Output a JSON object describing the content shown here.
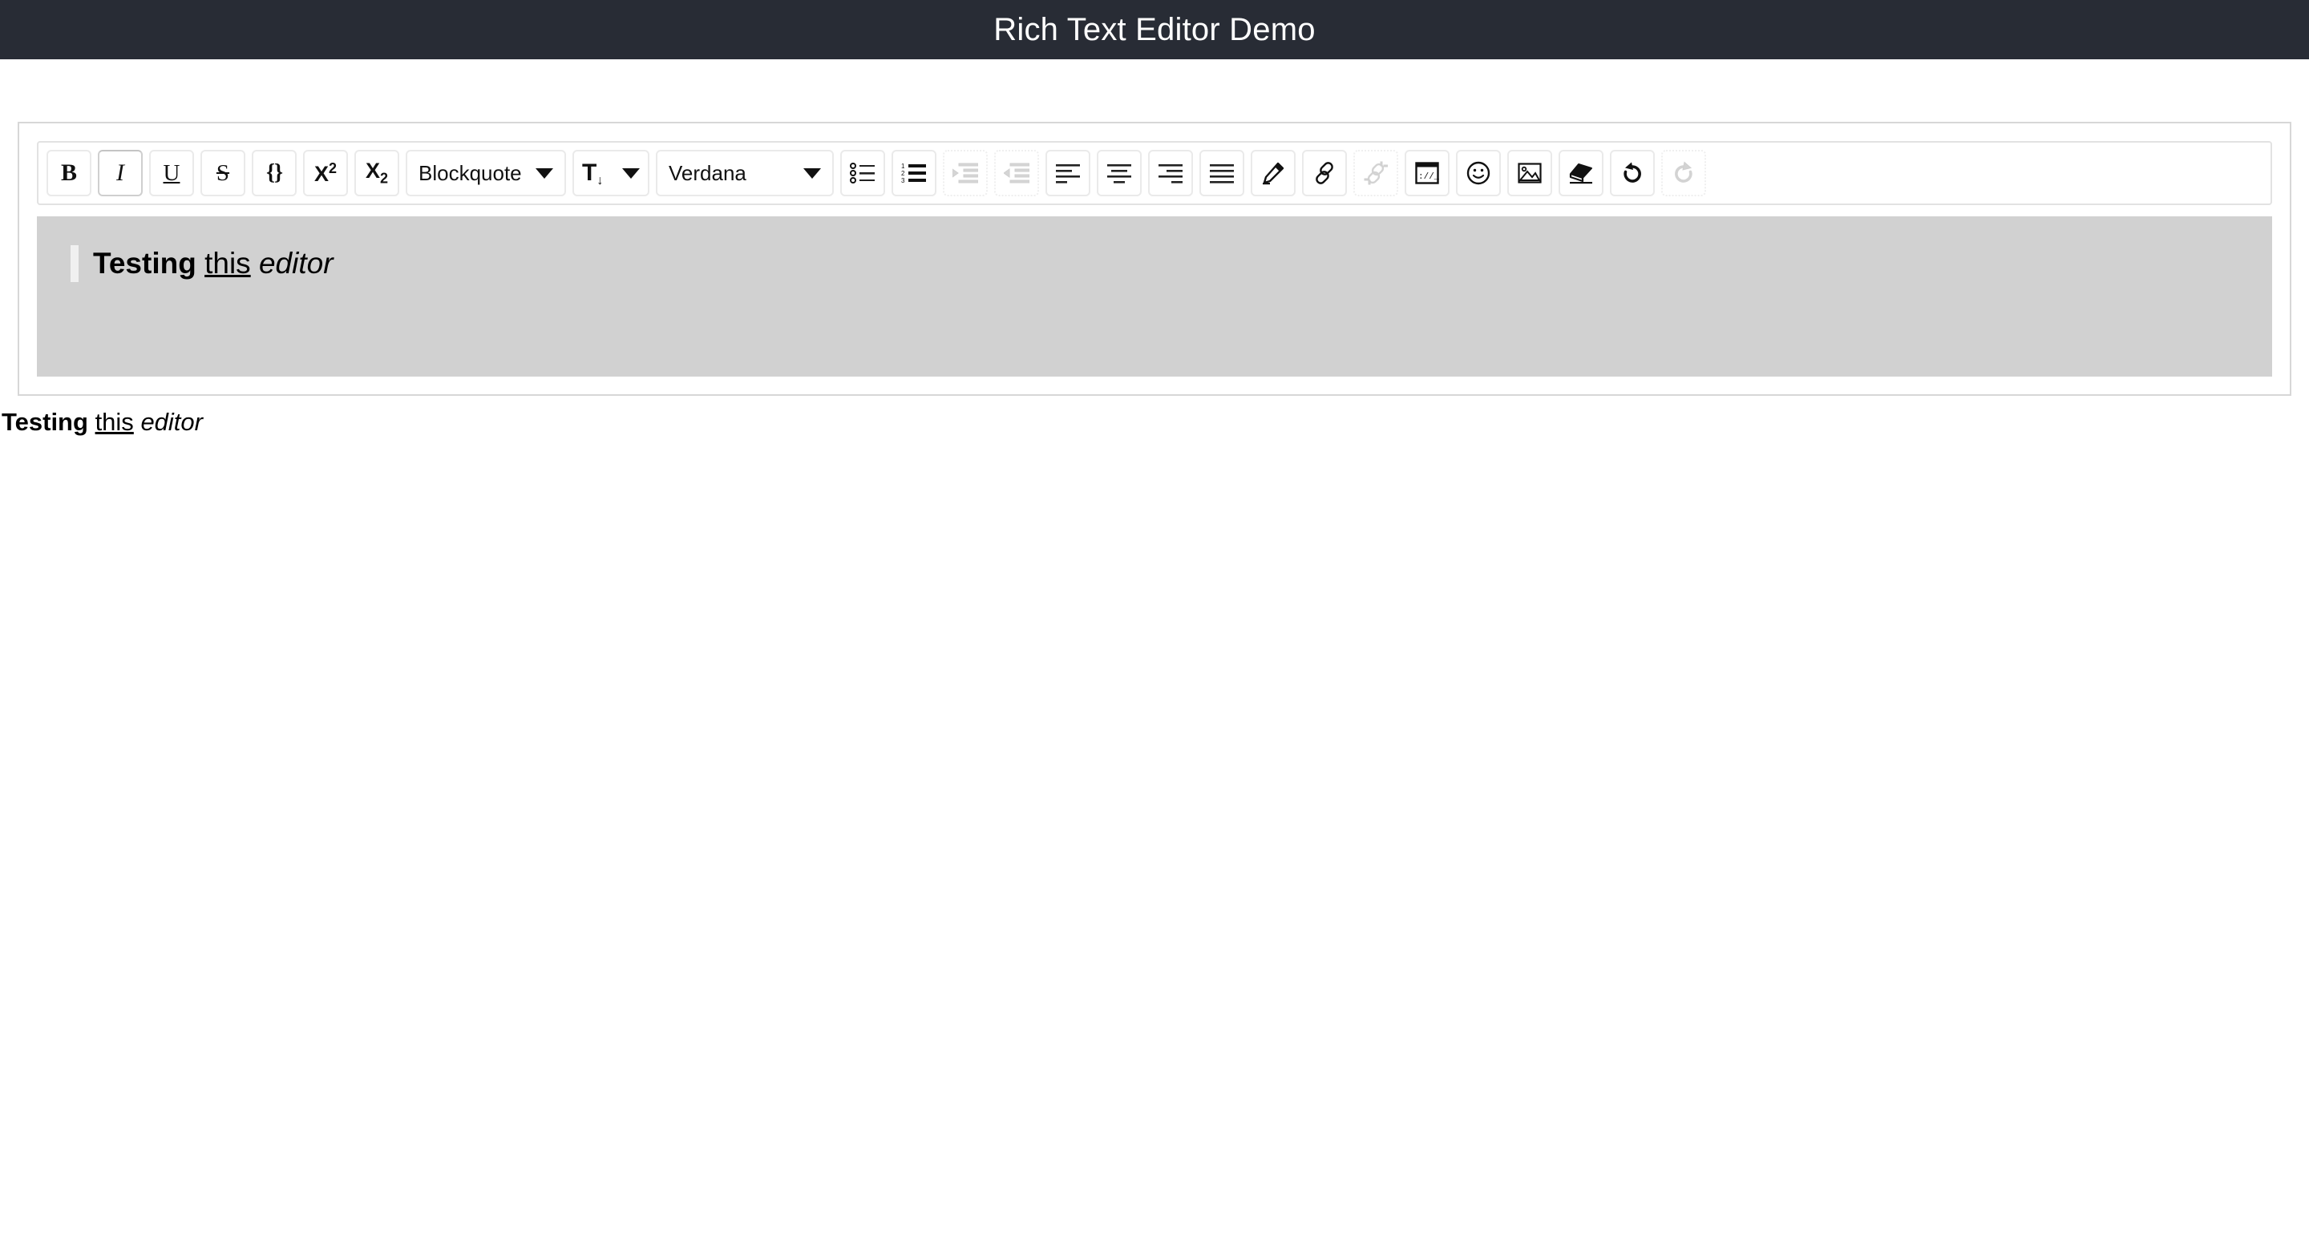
{
  "header": {
    "title": "Rich Text Editor Demo",
    "background": "#282c35",
    "text_color": "#ffffff"
  },
  "toolbar": {
    "buttons": [
      {
        "name": "bold",
        "label": "B",
        "icon": "bold-icon",
        "active": false,
        "disabled": false
      },
      {
        "name": "italic",
        "label": "I",
        "icon": "italic-icon",
        "active": true,
        "disabled": false
      },
      {
        "name": "underline",
        "label": "U",
        "icon": "underline-icon",
        "active": false,
        "disabled": false
      },
      {
        "name": "strikethrough",
        "label": "S",
        "icon": "strikethrough-icon",
        "active": false,
        "disabled": false
      },
      {
        "name": "code",
        "label": "{}",
        "icon": "code-icon",
        "active": false,
        "disabled": false
      },
      {
        "name": "superscript",
        "label": "X2",
        "icon": "superscript-icon",
        "active": false,
        "disabled": false
      },
      {
        "name": "subscript",
        "label": "X2",
        "icon": "subscript-icon",
        "active": false,
        "disabled": false
      }
    ],
    "block_format": {
      "name": "blockquote-dropdown",
      "selected": "Blockquote",
      "icon": "chevron-down-icon"
    },
    "font_size": {
      "name": "font-size-dropdown",
      "icon": "font-size-icon",
      "glyph": "T",
      "arrow": "↓",
      "caret": "chevron-down-icon"
    },
    "font_family": {
      "name": "font-family-dropdown",
      "selected": "Verdana",
      "icon": "chevron-down-icon"
    },
    "icon_buttons": [
      {
        "name": "bullet-list",
        "icon": "bullet-list-icon",
        "disabled": false
      },
      {
        "name": "numbered-list",
        "icon": "numbered-list-icon",
        "disabled": false
      },
      {
        "name": "indent",
        "icon": "indent-icon",
        "disabled": true
      },
      {
        "name": "outdent",
        "icon": "outdent-icon",
        "disabled": true
      },
      {
        "name": "align-left",
        "icon": "align-left-icon",
        "disabled": false
      },
      {
        "name": "align-center",
        "icon": "align-center-icon",
        "disabled": false
      },
      {
        "name": "align-right",
        "icon": "align-right-icon",
        "disabled": false
      },
      {
        "name": "align-justify",
        "icon": "align-justify-icon",
        "disabled": false
      },
      {
        "name": "text-color",
        "icon": "pen-icon",
        "disabled": false
      },
      {
        "name": "insert-link",
        "icon": "link-icon",
        "disabled": false
      },
      {
        "name": "remove-link",
        "icon": "unlink-icon",
        "disabled": true
      },
      {
        "name": "embed-url",
        "icon": "embed-window-icon",
        "disabled": false
      },
      {
        "name": "insert-emoji",
        "icon": "smiley-icon",
        "disabled": false
      },
      {
        "name": "insert-image",
        "icon": "image-icon",
        "disabled": false
      },
      {
        "name": "clear-format",
        "icon": "eraser-icon",
        "disabled": false
      },
      {
        "name": "undo",
        "icon": "undo-icon",
        "disabled": false
      },
      {
        "name": "redo",
        "icon": "redo-icon",
        "disabled": true
      }
    ]
  },
  "editor": {
    "background": "#d1d1d1",
    "blockquote_bar_color": "#f0f0f0",
    "content": {
      "bold_text": "Testing",
      "underline_text": "this",
      "italic_text": "editor"
    }
  },
  "preview": {
    "bold_text": "Testing",
    "underline_text": "this",
    "italic_text": "editor"
  }
}
